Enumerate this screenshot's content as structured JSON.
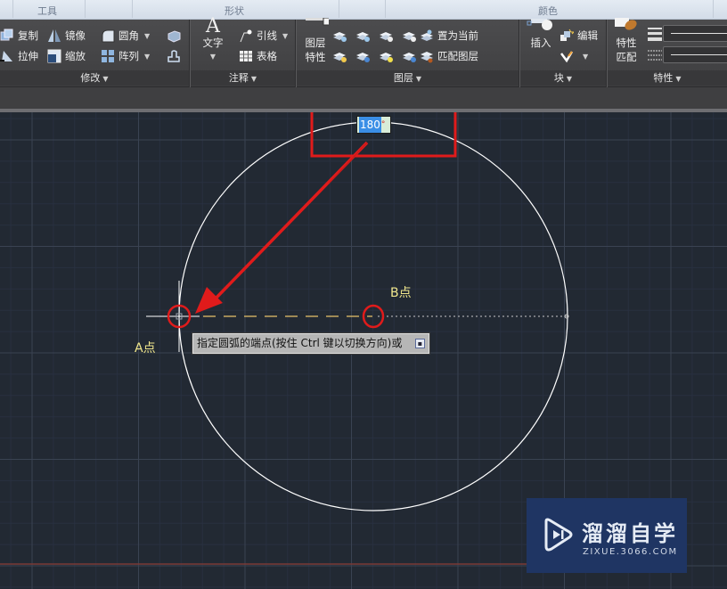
{
  "top_strip": {
    "tabs": [
      {
        "label": "工具"
      },
      {
        "label": "形状"
      },
      {
        "label": "颜色"
      }
    ]
  },
  "ribbon": {
    "modify": {
      "title": "修改",
      "items": [
        {
          "label": "复制",
          "icon": "copy-icon"
        },
        {
          "label": "镜像",
          "icon": "mirror-icon"
        },
        {
          "label": "圆角",
          "icon": "fillet-icon",
          "dropdown": true
        },
        {
          "label": "拉伸",
          "icon": "stretch-icon"
        },
        {
          "label": "缩放",
          "icon": "scale-icon"
        },
        {
          "label": "阵列",
          "icon": "array-icon",
          "dropdown": true
        }
      ]
    },
    "annotation": {
      "title": "注释",
      "text_label": "文字",
      "leader_label": "引线",
      "table_label": "表格"
    },
    "layers": {
      "title": "图层",
      "properties_label_1": "图层",
      "properties_label_2": "特性",
      "set_current_label": "置为当前",
      "match_layer_label": "匹配图层"
    },
    "block": {
      "title": "块",
      "insert_label": "插入",
      "edit_label": "编辑"
    },
    "properties": {
      "title": "特性",
      "match_label_1": "特性",
      "match_label_2": "匹配"
    }
  },
  "canvas": {
    "angle_input": {
      "value": "180",
      "unit": "°"
    },
    "point_a_label": "A点",
    "point_b_label": "B点",
    "command_tooltip": "指定圆弧的端点(按住 Ctrl 键以切换方向)或",
    "colors": {
      "highlight_red": "#e01b1b",
      "dashed_line": "#e8c36a",
      "label_yellow": "#f0e68c",
      "circle": "#ffffff",
      "background": "#222933"
    }
  },
  "watermark": {
    "title": "溜溜自学",
    "url": "ZIXUE.3066.COM"
  }
}
